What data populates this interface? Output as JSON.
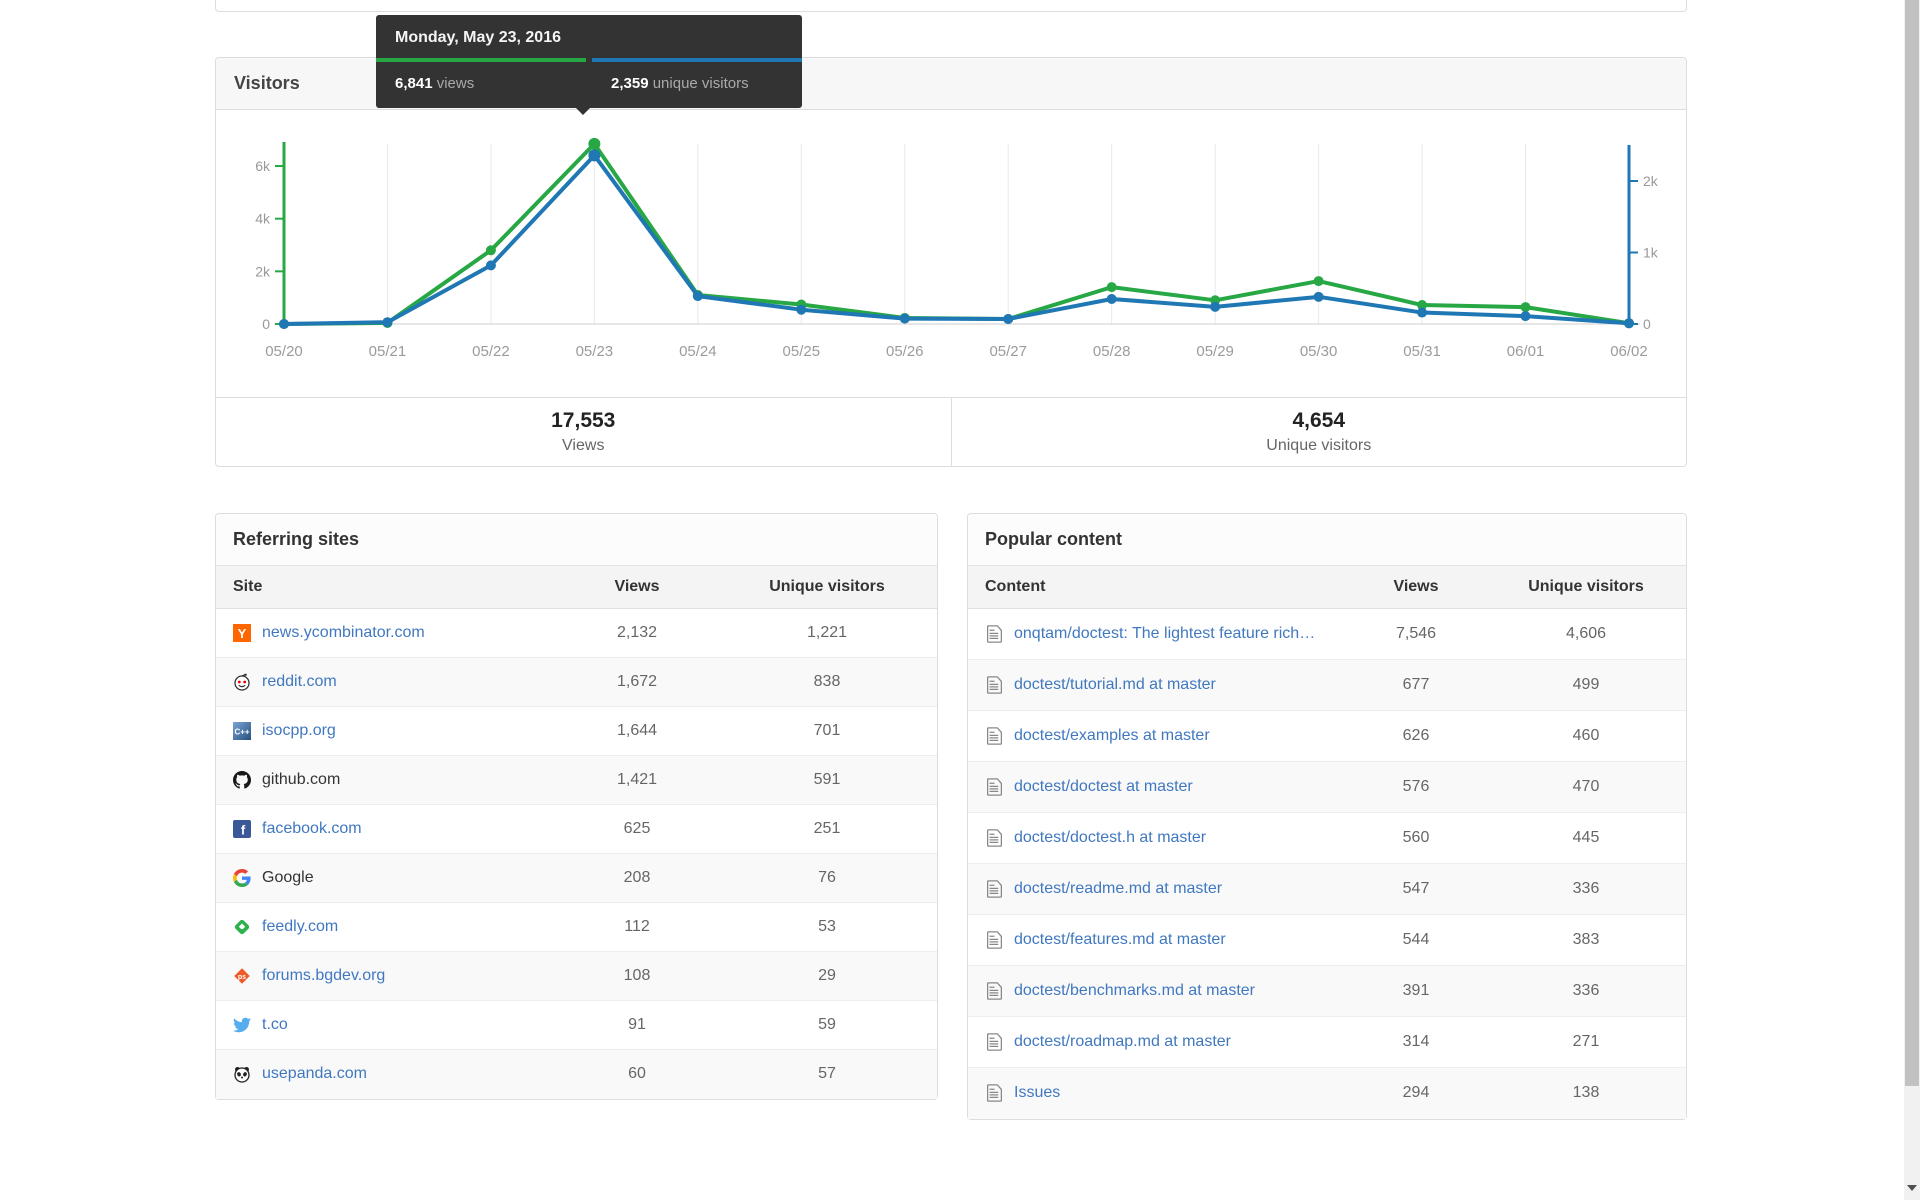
{
  "tooltip": {
    "date": "Monday, May 23, 2016",
    "views_value": "6,841",
    "views_label": "views",
    "unique_value": "2,359",
    "unique_label": "unique visitors"
  },
  "visitors_panel": {
    "title": "Visitors",
    "summary": {
      "views_value": "17,553",
      "views_label": "Views",
      "unique_value": "4,654",
      "unique_label": "Unique visitors"
    }
  },
  "chart_data": {
    "type": "line",
    "x": [
      "05/20",
      "05/21",
      "05/22",
      "05/23",
      "05/24",
      "05/25",
      "05/26",
      "05/27",
      "05/28",
      "05/29",
      "05/30",
      "05/31",
      "06/01",
      "06/02"
    ],
    "series": [
      {
        "name": "views",
        "color": "#28a745",
        "axis": "left",
        "values": [
          0,
          40,
          2800,
          6841,
          1100,
          740,
          230,
          190,
          1400,
          900,
          1630,
          720,
          640,
          30
        ]
      },
      {
        "name": "unique visitors",
        "color": "#1f77b4",
        "axis": "right",
        "values": [
          0,
          25,
          820,
          2359,
          390,
          200,
          75,
          70,
          350,
          240,
          380,
          160,
          110,
          10
        ]
      }
    ],
    "left_axis": {
      "tick_labels": [
        "6k",
        "4k",
        "2k",
        "0"
      ],
      "tick_values": [
        6000,
        4000,
        2000,
        0
      ],
      "max": 6900
    },
    "right_axis": {
      "tick_labels": [
        "2k",
        "1k",
        "0"
      ],
      "tick_values": [
        2000,
        1000,
        0
      ],
      "max": 2500
    },
    "hover_index": 3,
    "grid": true,
    "legend_position": "none",
    "title": "",
    "xlabel": "",
    "ylabel": ""
  },
  "referring": {
    "title": "Referring sites",
    "columns": [
      "Site",
      "Views",
      "Unique visitors"
    ],
    "rows": [
      {
        "site": "news.ycombinator.com",
        "views": "2,132",
        "unique": "1,221",
        "icon": "ycombinator-favicon",
        "link": true
      },
      {
        "site": "reddit.com",
        "views": "1,672",
        "unique": "838",
        "icon": "reddit-favicon",
        "link": true
      },
      {
        "site": "isocpp.org",
        "views": "1,644",
        "unique": "701",
        "icon": "isocpp-favicon",
        "link": true
      },
      {
        "site": "github.com",
        "views": "1,421",
        "unique": "591",
        "icon": "github-favicon",
        "link": false
      },
      {
        "site": "facebook.com",
        "views": "625",
        "unique": "251",
        "icon": "facebook-favicon",
        "link": true
      },
      {
        "site": "Google",
        "views": "208",
        "unique": "76",
        "icon": "google-favicon",
        "link": false
      },
      {
        "site": "feedly.com",
        "views": "112",
        "unique": "53",
        "icon": "feedly-favicon",
        "link": true
      },
      {
        "site": "forums.bgdev.org",
        "views": "108",
        "unique": "29",
        "icon": "bgdev-favicon",
        "link": true
      },
      {
        "site": "t.co",
        "views": "91",
        "unique": "59",
        "icon": "twitter-favicon",
        "link": true
      },
      {
        "site": "usepanda.com",
        "views": "60",
        "unique": "57",
        "icon": "panda-favicon",
        "link": true
      }
    ]
  },
  "popular": {
    "title": "Popular content",
    "columns": [
      "Content",
      "Views",
      "Unique visitors"
    ],
    "rows": [
      {
        "content": "onqtam/doctest: The lightest feature rich…",
        "views": "7,546",
        "unique": "4,606",
        "icon": "file-icon"
      },
      {
        "content": "doctest/tutorial.md at master",
        "views": "677",
        "unique": "499",
        "icon": "file-icon"
      },
      {
        "content": "doctest/examples at master",
        "views": "626",
        "unique": "460",
        "icon": "file-icon"
      },
      {
        "content": "doctest/doctest at master",
        "views": "576",
        "unique": "470",
        "icon": "file-icon"
      },
      {
        "content": "doctest/doctest.h at master",
        "views": "560",
        "unique": "445",
        "icon": "file-icon"
      },
      {
        "content": "doctest/readme.md at master",
        "views": "547",
        "unique": "336",
        "icon": "file-icon"
      },
      {
        "content": "doctest/features.md at master",
        "views": "544",
        "unique": "383",
        "icon": "file-icon"
      },
      {
        "content": "doctest/benchmarks.md at master",
        "views": "391",
        "unique": "336",
        "icon": "file-icon"
      },
      {
        "content": "doctest/roadmap.md at master",
        "views": "314",
        "unique": "271",
        "icon": "file-icon"
      },
      {
        "content": "Issues",
        "views": "294",
        "unique": "138",
        "icon": "file-icon"
      }
    ]
  },
  "colors": {
    "views_green": "#28a745",
    "unique_blue": "#1f77b4",
    "link_blue": "#4078c0",
    "tooltip_bg": "#333333",
    "panel_border": "#dddddd",
    "axis_label_gray": "#999999"
  }
}
